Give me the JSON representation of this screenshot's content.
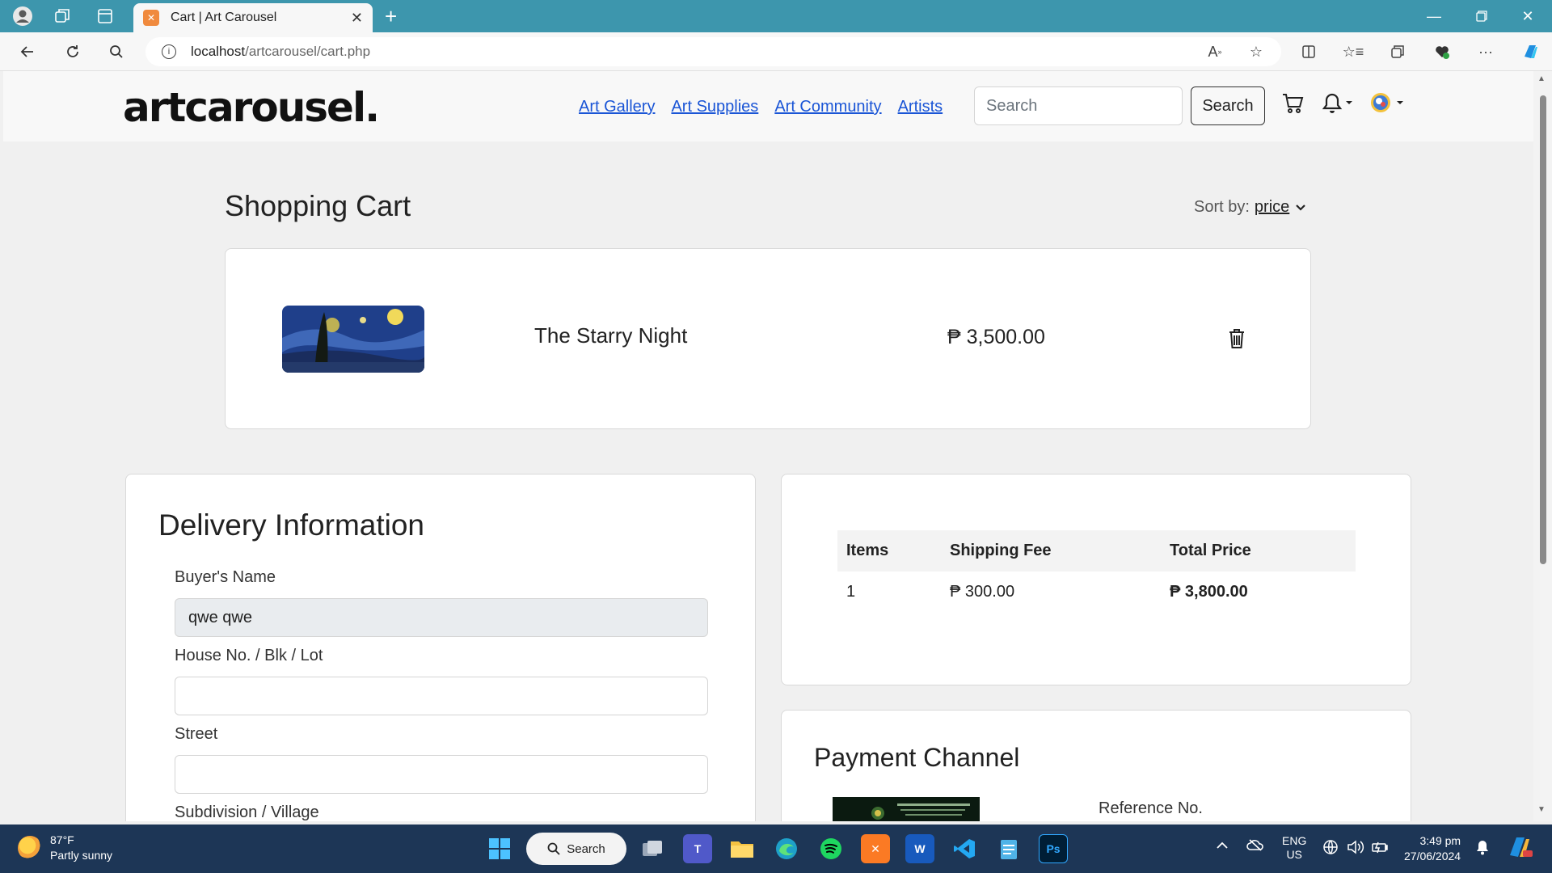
{
  "browser": {
    "tab_title": "Cart | Art Carousel",
    "favicon": "xampp-icon",
    "url_host": "localhost",
    "url_path": "/artcarousel/cart.php"
  },
  "site": {
    "logo": "artcarousel.",
    "nav": [
      "Art Gallery",
      "Art Supplies",
      "Art Community",
      "Artists"
    ],
    "search_placeholder": "Search",
    "search_button": "Search",
    "accent_color": "#1a55d6"
  },
  "cart": {
    "title": "Shopping Cart",
    "sort_label": "Sort by:",
    "sort_value": "price",
    "items": [
      {
        "name": "The Starry Night",
        "price": "₱ 3,500.00"
      }
    ]
  },
  "delivery": {
    "title": "Delivery Information",
    "fields": [
      {
        "label": "Buyer's Name",
        "value": "qwe qwe"
      },
      {
        "label": "House No. / Blk / Lot",
        "value": ""
      },
      {
        "label": "Street",
        "value": ""
      },
      {
        "label": "Subdivision / Village",
        "value": ""
      }
    ]
  },
  "summary": {
    "headers": [
      "Items",
      "Shipping Fee",
      "Total Price"
    ],
    "items": "1",
    "shipping_fee": "₱ 300.00",
    "total": "₱ 3,800.00"
  },
  "payment": {
    "title": "Payment Channel",
    "reference_label": "Reference No."
  },
  "taskbar": {
    "temperature": "87°F",
    "weather": "Partly sunny",
    "search": "Search",
    "lang1": "ENG",
    "lang2": "US",
    "time": "3:49 pm",
    "date": "27/06/2024"
  }
}
